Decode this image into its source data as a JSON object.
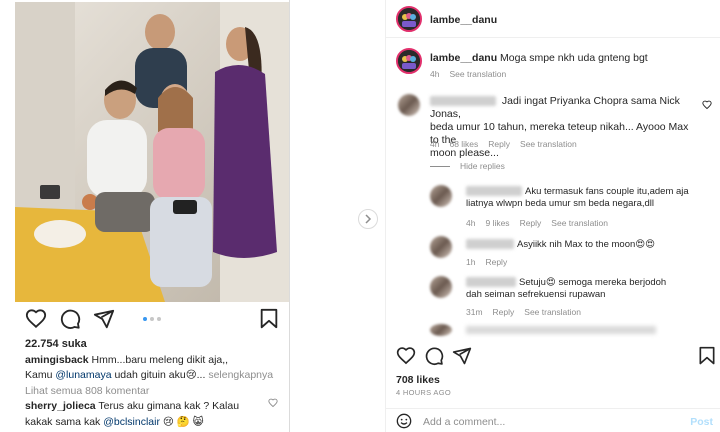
{
  "left_post": {
    "likes": "22.754 suka",
    "comment1": {
      "username": "amingisback",
      "text_line1": "Hmm...baru meleng dikit aja,,",
      "text_line2_pre": "Kamu ",
      "mention": "@lunamaya",
      "text_line2_post": " udah gituin aku😢...",
      "more": "selengkapnya"
    },
    "view_all_comments": "Lihat semua 808 komentar",
    "comment2": {
      "username": "sherry_jolieca",
      "text_line1": "Terus aku gimana kak ? Kalau",
      "text_line2_pre": "kakak sama kak ",
      "mention": "@bclsinclair",
      "text_line2_post": " 😢 🤔 😸"
    }
  },
  "right_post": {
    "header_username": "lambe__danu",
    "caption": {
      "username": "lambe__danu",
      "text": "Moga smpe nkh uda gnteng bgt",
      "time": "4h",
      "see_translation": "See translation"
    },
    "comments": [
      {
        "text": "Jadi ingat Priyanka Chopra sama Nick Jonas, beda umur 10 tahun, mereka teteup nikah... Ayooo Max to the moon please...",
        "lines": [
          "Jadi ingat Priyanka Chopra sama Nick Jonas,",
          "beda umur 10 tahun, mereka teteup nikah... Ayooo Max to the",
          "moon please..."
        ],
        "time": "4h",
        "likes": "68 likes",
        "reply": "Reply",
        "see_translation": "See translation"
      }
    ],
    "hide_replies": "Hide replies",
    "replies": [
      {
        "lines": [
          "Aku termasuk fans couple itu,adem aja",
          "liatnya wlwpn beda umur sm beda negara,dll"
        ],
        "time": "4h",
        "likes": "9 likes",
        "reply": "Reply",
        "see_translation": "See translation"
      },
      {
        "lines": [
          "Asyiikk nih Max to the moon😍😍"
        ],
        "time": "1h",
        "reply": "Reply"
      },
      {
        "lines": [
          "Setuju😍 semoga mereka berjodoh",
          "dah seiman sefrekuensi rupawan"
        ],
        "time": "31m",
        "reply": "Reply",
        "see_translation": "See translation"
      }
    ],
    "likes": "708 likes",
    "time_ago": "4 HOURS AGO",
    "add_comment_placeholder": "Add a comment...",
    "post_label": "Post"
  },
  "colors": {
    "link_blue": "#00376b",
    "muted_grey": "#8e8e8e",
    "post_button_disabled": "#b2dffc",
    "carousel_active_dot": "#3897f0"
  },
  "icons": [
    "heart-icon",
    "comment-icon",
    "share-icon",
    "bookmark-icon",
    "chevron-right-icon",
    "emoji-icon"
  ]
}
